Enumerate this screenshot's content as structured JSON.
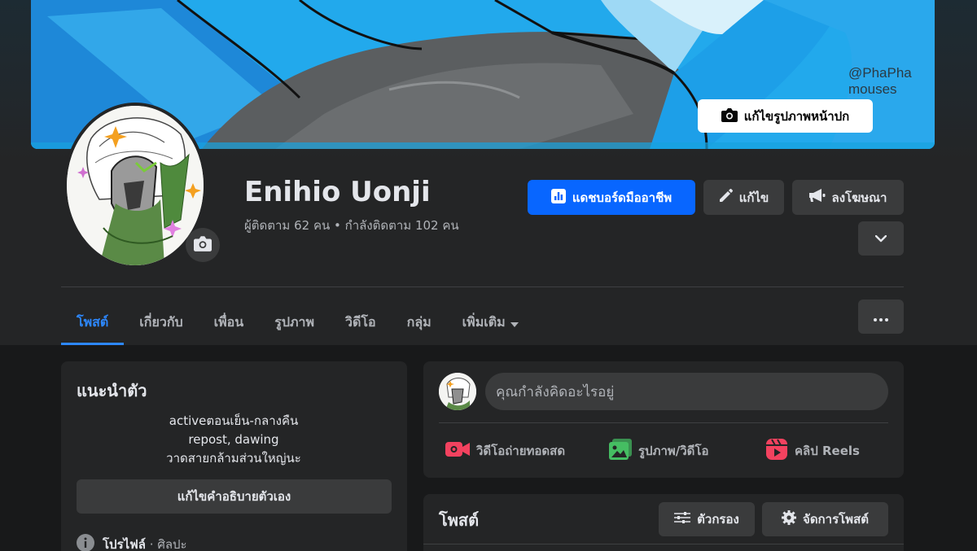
{
  "cover": {
    "watermark_line1": "@PhaPha",
    "watermark_line2": "mouses",
    "edit_cover_label": "แก้ไขรูปภาพหน้าปก"
  },
  "profile": {
    "name": "Enihio Uonji",
    "followers_text": "ผู้ติดตาม 62 คน • กำลังติดตาม 102 คน"
  },
  "actions": {
    "dashboard_label": "แดชบอร์ดมืออาชีพ",
    "edit_label": "แก้ไข",
    "advertise_label": "ลงโฆษณา"
  },
  "tabs": [
    {
      "label": "โพสต์",
      "active": true
    },
    {
      "label": "เกี่ยวกับ"
    },
    {
      "label": "เพื่อน"
    },
    {
      "label": "รูปภาพ"
    },
    {
      "label": "วิดีโอ"
    },
    {
      "label": "กลุ่ม"
    },
    {
      "label": "เพิ่มเติม"
    }
  ],
  "intro": {
    "title": "แนะนำตัว",
    "bio_lines": [
      "activeตอนเย็น-กลางคืน",
      "repost, dawing",
      "วาดสายกล้ามส่วนใหญ่นะ"
    ],
    "edit_bio_label": "แก้ไขคำอธิบายตัวเอง",
    "profile_label": "โปรไฟล์",
    "profile_category": "· ศิลปะ"
  },
  "composer": {
    "placeholder": "คุณกำลังคิดอะไรอยู่",
    "live_label": "วิดีโอถ่ายทอดสด",
    "photo_label": "รูปภาพ/วิดีโอ",
    "reels_label": "คลิป Reels"
  },
  "posts": {
    "title": "โพสต์",
    "filter_label": "ตัวกรอง",
    "manage_label": "จัดการโพสต์"
  },
  "colors": {
    "accent": "#0866ff",
    "active_tab": "#2d88ff",
    "live_icon": "#f3425f",
    "photo_icon": "#45bd62",
    "reels_icon": "#f3425f"
  }
}
